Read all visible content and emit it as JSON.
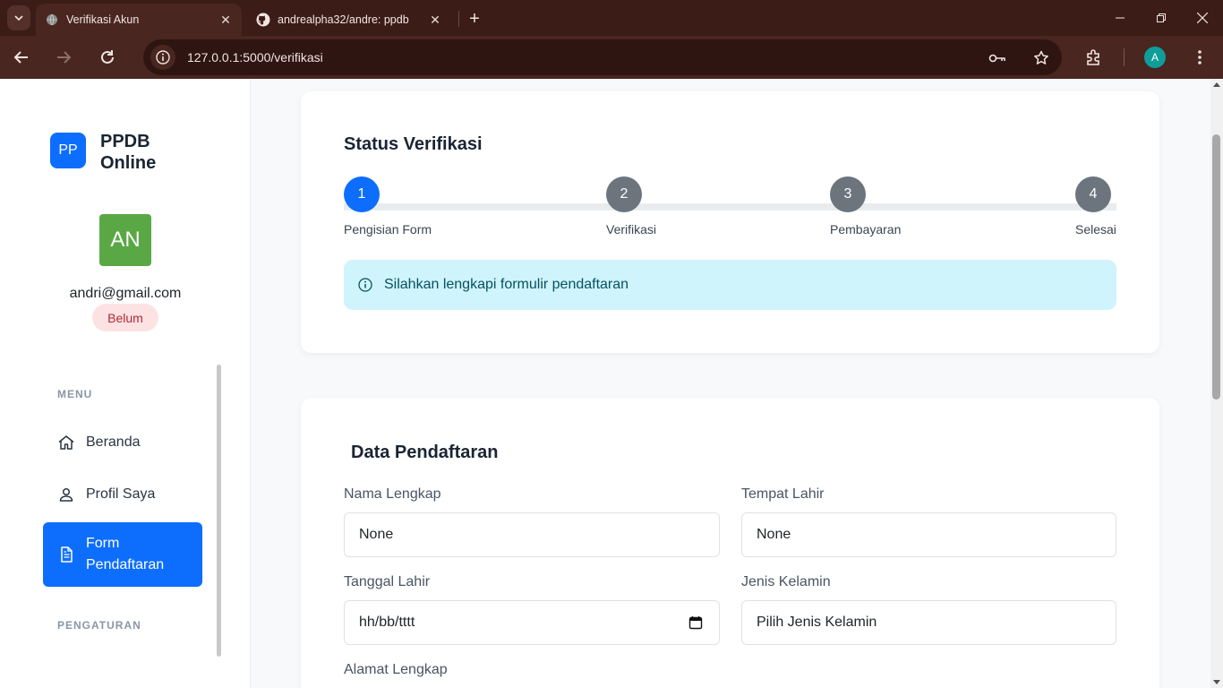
{
  "browser": {
    "tabs": [
      {
        "title": "Verifikasi Akun",
        "active": true
      },
      {
        "title": "andrealpha32/andre: ppdb",
        "active": false
      }
    ],
    "url": "127.0.0.1:5000/verifikasi",
    "profile_initial": "A"
  },
  "sidebar": {
    "logo_badge": "PP",
    "logo_text": "PPDB Online",
    "avatar_initials": "AN",
    "email": "andri@gmail.com",
    "status": "Belum",
    "menu_heading": "MENU",
    "items": [
      {
        "label": "Beranda",
        "icon": "home-icon"
      },
      {
        "label": "Profil Saya",
        "icon": "user-icon"
      },
      {
        "label": "Form Pendaftaran",
        "icon": "document-icon",
        "active": true
      }
    ],
    "settings_heading": "PENGATURAN"
  },
  "status_card": {
    "title": "Status Verifikasi",
    "steps": [
      {
        "number": "1",
        "label": "Pengisian Form"
      },
      {
        "number": "2",
        "label": "Verifikasi"
      },
      {
        "number": "3",
        "label": "Pembayaran"
      },
      {
        "number": "4",
        "label": "Selesai"
      }
    ],
    "alert": "Silahkan lengkapi formulir pendaftaran"
  },
  "form_card": {
    "title": "Data Pendaftaran",
    "fields": {
      "nama_lengkap": {
        "label": "Nama Lengkap",
        "value": "None"
      },
      "tempat_lahir": {
        "label": "Tempat Lahir",
        "value": "None"
      },
      "tanggal_lahir": {
        "label": "Tanggal Lahir",
        "value": "hh/bb/tttt"
      },
      "jenis_kelamin": {
        "label": "Jenis Kelamin",
        "value": "Pilih Jenis Kelamin"
      },
      "alamat_lengkap": {
        "label": "Alamat Lengkap"
      }
    }
  },
  "colors": {
    "primary": "#0d6efd",
    "step_inactive": "#6c757d",
    "alert_bg": "#cff4fc",
    "badge_bg": "#fde2e4",
    "avatar_bg": "#5aa845",
    "chrome_bg": "#3b1c16"
  }
}
